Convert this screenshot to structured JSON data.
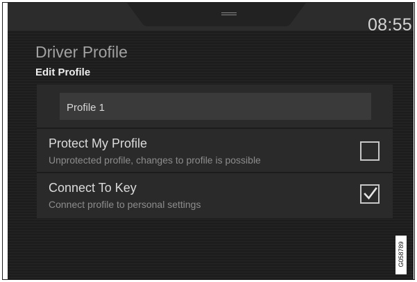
{
  "status": {
    "time": "08:55"
  },
  "header": {
    "title": "Driver Profile",
    "subtitle": "Edit Profile"
  },
  "profile": {
    "name": "Profile 1"
  },
  "options": [
    {
      "title": "Protect My Profile",
      "description": "Unprotected profile, changes to profile is possible",
      "checked": false
    },
    {
      "title": "Connect To Key",
      "description": "Connect profile to personal settings",
      "checked": true
    }
  ],
  "image_code": "G058789",
  "colors": {
    "background": "#1d1d1d",
    "panel": "#2a2a2a",
    "field": "#3a3a3a",
    "text": "#dcdcdc",
    "muted": "#8d8d8d"
  }
}
